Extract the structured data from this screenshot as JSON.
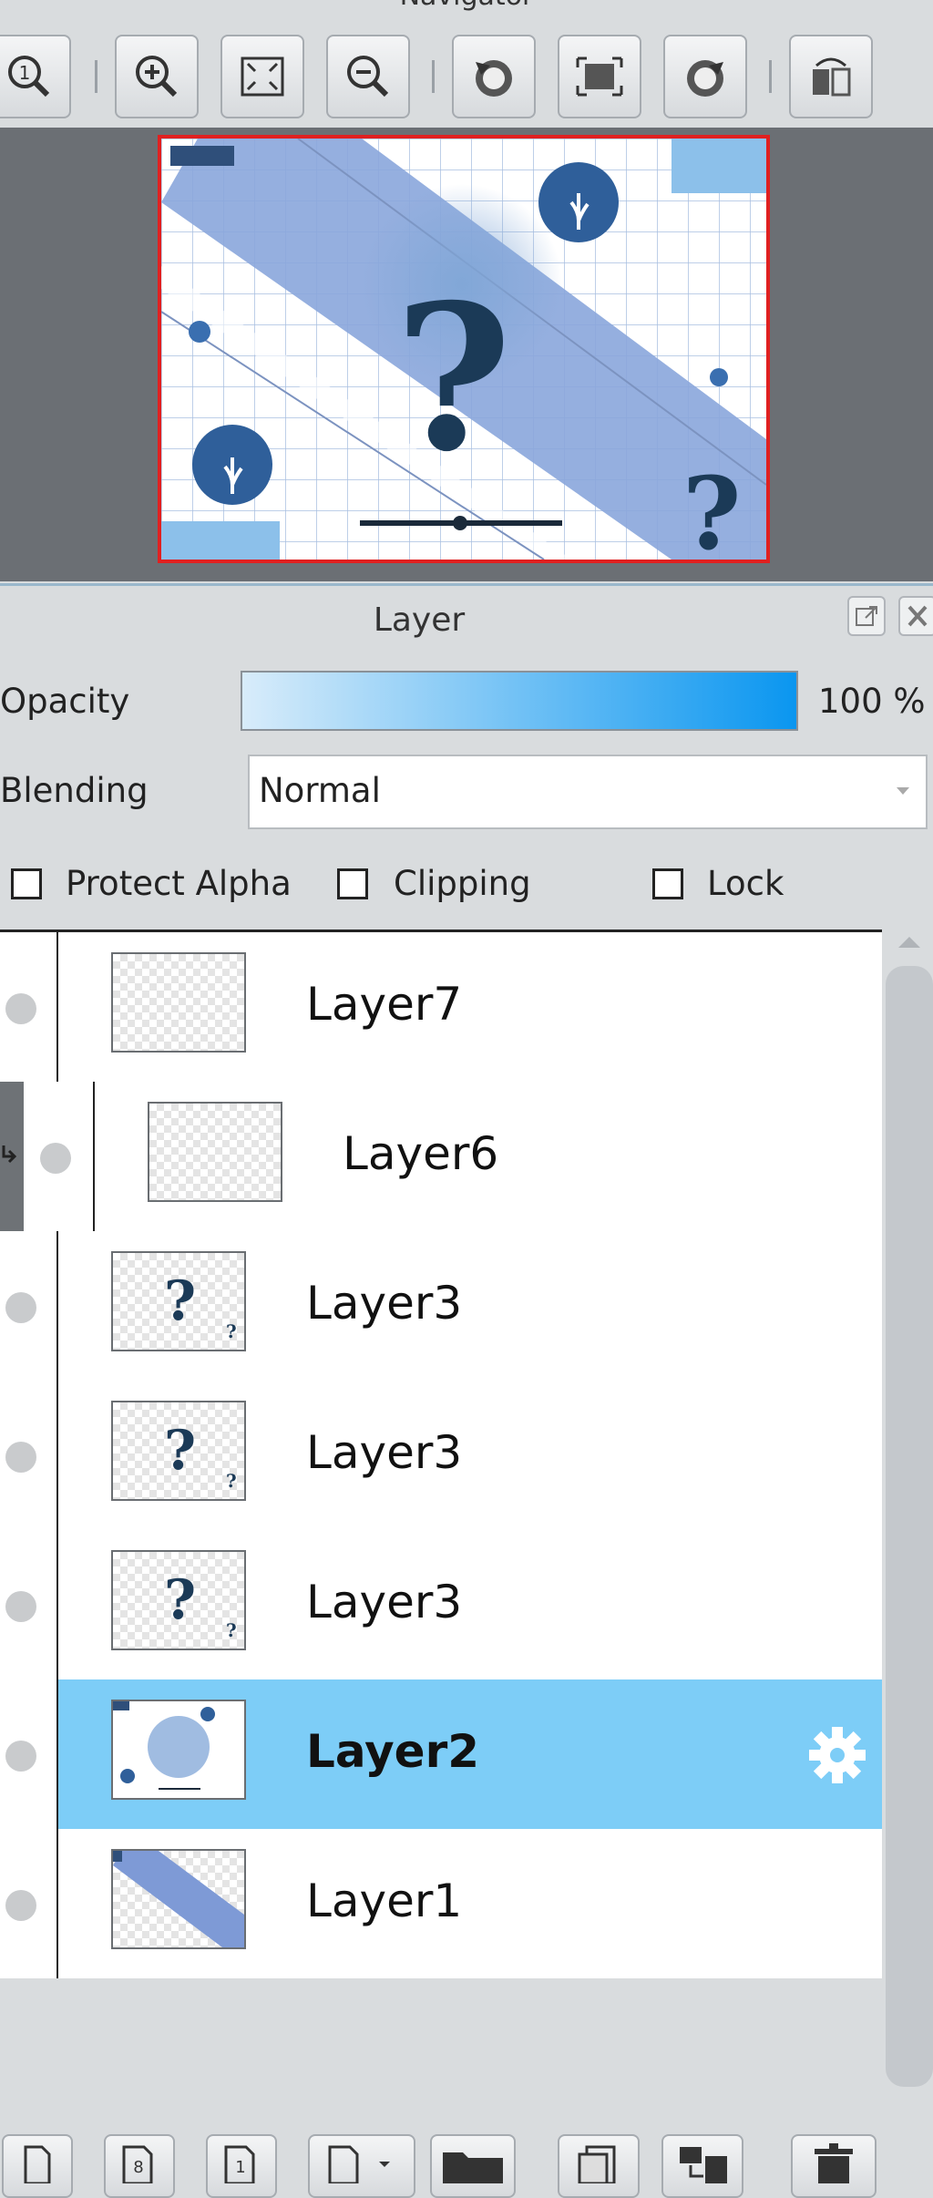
{
  "navigator": {
    "title": "Navigator",
    "toolbar": [
      {
        "name": "zoom-actual-icon"
      },
      {
        "name": "zoom-in-icon"
      },
      {
        "name": "fit-screen-icon"
      },
      {
        "name": "zoom-out-icon"
      },
      {
        "name": "rotate-left-icon"
      },
      {
        "name": "reset-view-icon"
      },
      {
        "name": "rotate-right-icon"
      },
      {
        "name": "flip-horizontal-icon"
      }
    ],
    "preview": {
      "question_mark": "?",
      "small_question_mark": "?"
    }
  },
  "layer_panel": {
    "title": "Layer",
    "opacity_label": "Opacity",
    "opacity_value": "100 %",
    "opacity_level": 1.0,
    "blending_label": "Blending",
    "blending_value": "Normal",
    "checkboxes": {
      "protect_alpha": "Protect Alpha",
      "clipping": "Clipping",
      "lock": "Lock"
    },
    "layers": [
      {
        "name": "Layer7",
        "thumb": "empty",
        "indented": false,
        "selected": false
      },
      {
        "name": "Layer6",
        "thumb": "empty",
        "indented": true,
        "selected": false
      },
      {
        "name": "Layer3",
        "thumb": "question",
        "indented": false,
        "selected": false
      },
      {
        "name": "Layer3",
        "thumb": "question",
        "indented": false,
        "selected": false
      },
      {
        "name": "Layer3",
        "thumb": "question",
        "indented": false,
        "selected": false
      },
      {
        "name": "Layer2",
        "thumb": "art",
        "indented": false,
        "selected": true
      },
      {
        "name": "Layer1",
        "thumb": "stripe",
        "indented": false,
        "selected": false
      }
    ],
    "thumb_question_mark": "?",
    "thumb_small_question_mark": "?",
    "bottom_toolbar": [
      {
        "name": "new-layer-icon"
      },
      {
        "name": "new-8bit-layer-icon"
      },
      {
        "name": "new-1bit-layer-icon"
      },
      {
        "name": "new-layer-menu-icon"
      },
      {
        "name": "new-folder-icon"
      },
      {
        "name": "duplicate-layer-icon"
      },
      {
        "name": "merge-down-icon"
      },
      {
        "name": "delete-layer-icon"
      }
    ]
  },
  "colors": {
    "accent": "#0a96f0",
    "selected_row": "#7dcdf7",
    "canvas_bg": "#6b6f74",
    "frame": "#e02020"
  }
}
